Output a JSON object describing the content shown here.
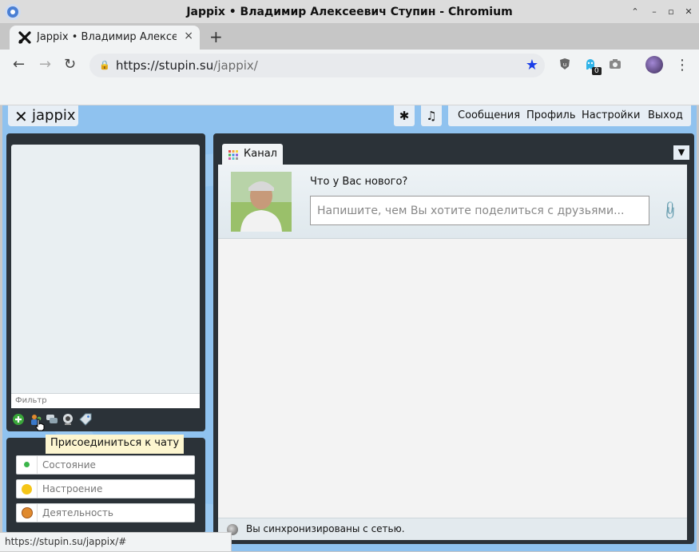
{
  "window": {
    "title": "Jappix • Владимир Алексеевич Ступин - Chromium"
  },
  "tab": {
    "title": "Jappix • Владимир Алексе",
    "close": "×",
    "new_tab": "+"
  },
  "nav": {
    "back": "←",
    "forward": "→",
    "reload": "↻"
  },
  "omnibox": {
    "url_host": "https://stupin.su",
    "url_path": "/jappix/",
    "lock": "🔒"
  },
  "extensions": {
    "counter_badge": "0"
  },
  "jappix": {
    "logo_name": "jappix",
    "star_btn": "✱",
    "music_btn": "♫",
    "menu": [
      "Сообщения",
      "Профиль",
      "Настройки",
      "Выход"
    ]
  },
  "roster": {
    "filter_placeholder": "Фильтр"
  },
  "tooltip": {
    "text": "Присоединиться к чату"
  },
  "presence": {
    "fields": [
      "Состояние",
      "Настроение",
      "Деятельность"
    ]
  },
  "channel": {
    "tab_label": "Канал",
    "prompt": "Что у Вас нового?",
    "input_placeholder": "Напишите, чем Вы хотите поделиться с друзьями...",
    "sync_text": "Вы синхронизированы с сетью."
  },
  "status_bar": {
    "url": "https://stupin.su/jappix/#"
  },
  "colors": {
    "page_bg": "#8fc2ef",
    "panel_bg": "#2b3238",
    "star": "#1a3ee8"
  }
}
